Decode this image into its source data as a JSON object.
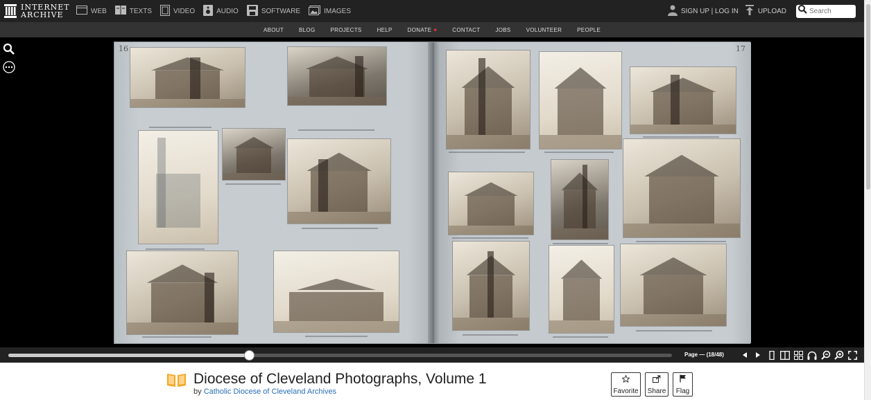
{
  "site": {
    "logo_line1": "INTERNET",
    "logo_line2": "ARCHIVE"
  },
  "media_nav": [
    {
      "label": "WEB",
      "icon": "web-icon"
    },
    {
      "label": "TEXTS",
      "icon": "texts-icon"
    },
    {
      "label": "VIDEO",
      "icon": "video-icon"
    },
    {
      "label": "AUDIO",
      "icon": "audio-icon"
    },
    {
      "label": "SOFTWARE",
      "icon": "software-icon"
    },
    {
      "label": "IMAGES",
      "icon": "images-icon"
    }
  ],
  "account": {
    "signup_login": "SIGN UP | LOG IN",
    "upload": "UPLOAD"
  },
  "search": {
    "placeholder": "Search"
  },
  "sub_nav": [
    "ABOUT",
    "BLOG",
    "PROJECTS",
    "HELP",
    "DONATE",
    "CONTACT",
    "JOBS",
    "VOLUNTEER",
    "PEOPLE"
  ],
  "book": {
    "left_page_number": "16",
    "right_page_number": "17"
  },
  "reader": {
    "page_label": "Page — (18/48)",
    "progress_fraction": 0.363
  },
  "item": {
    "title": "Diocese of Cleveland Photographs, Volume 1",
    "by_prefix": "by",
    "author": "Catholic Diocese of Cleveland Archives"
  },
  "actions": {
    "favorite": "Favorite",
    "share": "Share",
    "flag": "Flag"
  },
  "colors": {
    "topbar": "#222222",
    "subbar": "#333333",
    "link": "#2a6eb8",
    "donate_heart": "#e33333"
  }
}
